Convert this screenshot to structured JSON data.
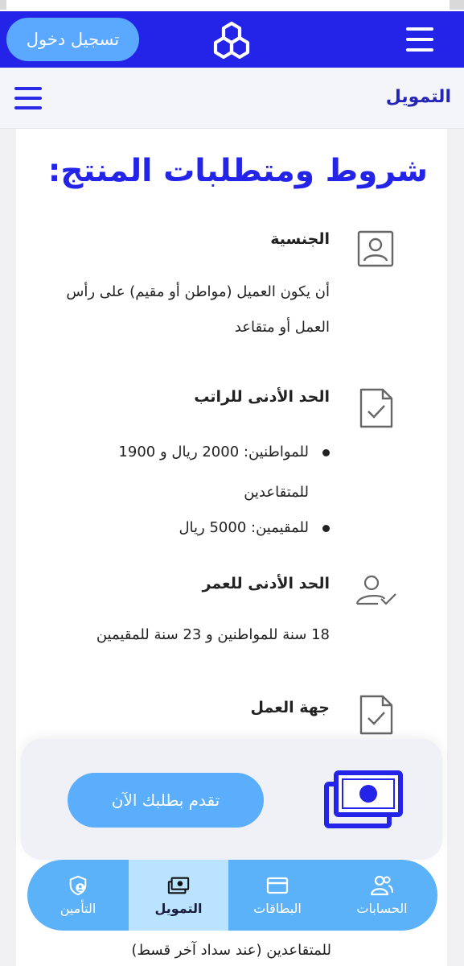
{
  "header": {
    "login_label": "تسجيل دخول",
    "logo_icon": "bank-logo-icon",
    "menu_icon": "hamburger-menu-icon"
  },
  "subbar": {
    "title": "التمويل",
    "menu_icon": "hamburger-menu-icon"
  },
  "page": {
    "title": "شروط ومتطلبات المنتج:"
  },
  "sections": {
    "nationality": {
      "icon": "id-card-icon",
      "title": "الجنسية",
      "lines": [
        "أن يكون العميل (مواطن أو مقيم) على رأس",
        "العمل أو متقاعد"
      ]
    },
    "salary": {
      "icon": "document-check-icon",
      "title": "الحد الأدنى للراتب",
      "bullets": [
        [
          "للمواطنين: 2000 ريال و 1900",
          "للمتقاعدين"
        ],
        [
          "للمقيمين: 5000 ريال"
        ]
      ]
    },
    "age": {
      "icon": "user-check-icon",
      "title": "الحد الأدنى للعمر",
      "text": "18 سنة للمواطنين و 23 سنة للمقيمين"
    },
    "employer": {
      "icon": "document-check-icon",
      "title": "جهة العمل"
    }
  },
  "cta": {
    "apply_label": "تقدم بطلبك الآن",
    "icon": "money-stack-icon"
  },
  "footer_peek": "للمتقاعدين (عند سداد آخر قسط)",
  "bottom_nav": {
    "items": [
      {
        "label": "الحسابات",
        "icon": "users-icon"
      },
      {
        "label": "البطاقات",
        "icon": "credit-card-icon"
      },
      {
        "label": "التمويل",
        "icon": "money-icon",
        "active": true
      },
      {
        "label": "التأمين",
        "icon": "shield-user-icon"
      }
    ]
  },
  "colors": {
    "brand_blue": "#2424e8",
    "light_blue": "#5aa8ff",
    "nav_active": "#b9e3ff"
  }
}
